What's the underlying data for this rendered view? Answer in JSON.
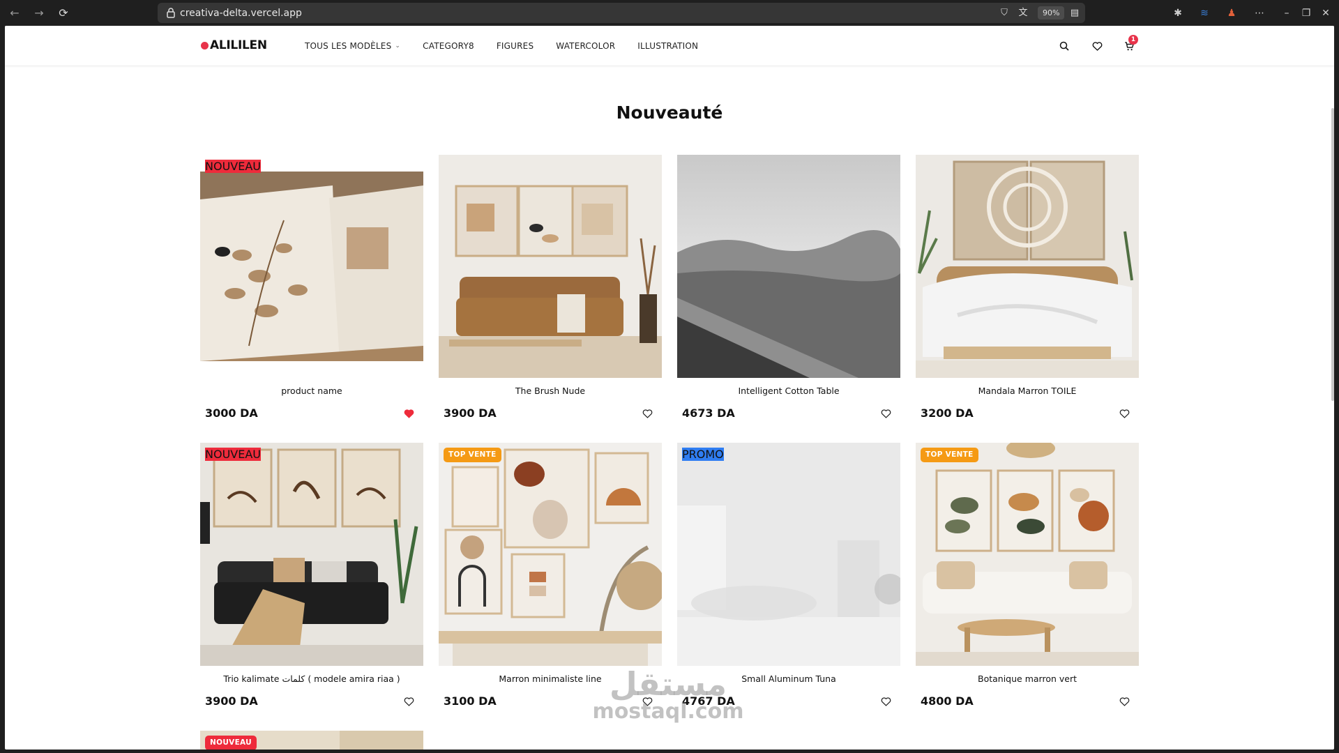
{
  "browser": {
    "url": "creativa-delta.vercel.app",
    "zoom": "90%"
  },
  "site": {
    "logo": "ALILILEN",
    "menu": [
      {
        "label": "TOUS LES MODÈLES",
        "has_dropdown": true
      },
      {
        "label": "CATEGORY8"
      },
      {
        "label": "FIGURES"
      },
      {
        "label": "WATERCOLOR"
      },
      {
        "label": "ILLUSTRATION"
      }
    ],
    "icons": [
      "search-icon",
      "heart-icon",
      "cart-icon"
    ],
    "cart_count": "1"
  },
  "section": {
    "title": "Nouveauté"
  },
  "products": [
    {
      "name": "product name",
      "price": "3000 DA",
      "badge": "NOUVEAU",
      "wishlisted": true
    },
    {
      "name": "The Brush Nude",
      "price": "3900 DA",
      "badge": "",
      "wishlisted": false
    },
    {
      "name": "Intelligent Cotton Table",
      "price": "4673 DA",
      "badge": "",
      "wishlisted": false
    },
    {
      "name": "Mandala Marron TOILE",
      "price": "3200 DA",
      "badge": "",
      "wishlisted": false
    },
    {
      "name": "Trio kalimate كلمات ( modele amira riaa )",
      "price": "3900 DA",
      "badge": "NOUVEAU",
      "wishlisted": false
    },
    {
      "name": "Marron minimaliste line",
      "price": "3100 DA",
      "badge": "TOP VENTE",
      "wishlisted": false
    },
    {
      "name": "Small Aluminum Tuna",
      "price": "4767 DA",
      "badge": "PROMO",
      "wishlisted": false
    },
    {
      "name": "Botanique marron vert",
      "price": "4800 DA",
      "badge": "TOP VENTE",
      "wishlisted": false
    },
    {
      "name": "",
      "price": "",
      "badge": "NOUVEAU",
      "wishlisted": false
    }
  ],
  "colors": {
    "accent_red": "#ee2b3b",
    "badge_top": "#f59a14",
    "badge_promo": "#2f7df2"
  },
  "watermark": {
    "arabic": "مستقل",
    "latin": "mostaql.com"
  }
}
